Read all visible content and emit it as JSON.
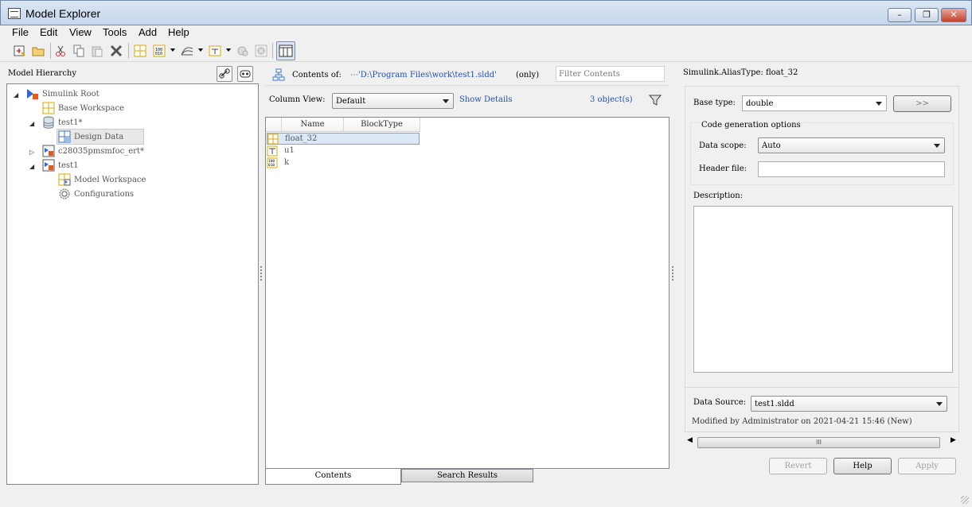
{
  "window": {
    "title": "Model Explorer",
    "minimize_label": "–",
    "restore_label": "❐",
    "close_label": "✕"
  },
  "menu": [
    {
      "label": "File",
      "mnemonic": "F"
    },
    {
      "label": "Edit",
      "mnemonic": "E"
    },
    {
      "label": "View",
      "mnemonic": "V"
    },
    {
      "label": "Tools",
      "mnemonic": "T"
    },
    {
      "label": "Add",
      "mnemonic": "A"
    },
    {
      "label": "Help",
      "mnemonic": "H"
    }
  ],
  "toolbar_icons": [
    "new-model-icon",
    "open-folder-icon",
    "cut-icon",
    "copy-icon",
    "paste-icon",
    "delete-icon",
    "add-workspace-variable-icon",
    "add-parameter-icon",
    "add-signal-icon",
    "add-bus-icon",
    "add-configuration-icon",
    "add-config-ref-icon",
    "dialog-view-icon"
  ],
  "model_hierarchy": {
    "title": "Model Hierarchy",
    "nodes": [
      {
        "label": "Simulink Root",
        "expander": "◢"
      },
      {
        "label": "Base Workspace"
      },
      {
        "label": "test1*",
        "expander": "◢"
      },
      {
        "label": "Design Data"
      },
      {
        "label": "c28035pmsmfoc_ert*",
        "expander": "▷"
      },
      {
        "label": "test1",
        "expander": "◢"
      },
      {
        "label": "Model Workspace"
      },
      {
        "label": "Configurations"
      }
    ]
  },
  "contents": {
    "contents_of_label": "Contents of:",
    "path": "⋯'D:\\Program Files\\work\\test1.sldd'",
    "only_label": "(only)",
    "filter_placeholder": "Filter Contents",
    "column_view_label": "Column View:",
    "column_view_value": "Default",
    "show_details": "Show Details",
    "object_count": "3 object(s)",
    "columns": [
      "Name",
      "BlockType"
    ],
    "rows": [
      {
        "name": "float_32",
        "icon": "alias-type-icon"
      },
      {
        "name": "u1",
        "icon": "bus-icon"
      },
      {
        "name": "k",
        "icon": "parameter-icon"
      }
    ],
    "tabs": [
      {
        "label": "Contents",
        "mnemonic": "C"
      },
      {
        "label": "Search Results",
        "mnemonic": "S"
      }
    ]
  },
  "dialog": {
    "title": "Simulink.AliasType: float_32",
    "base_type_label": "Base type:",
    "base_type_value": "double",
    "expand_button": ">>",
    "code_gen_label": "Code generation options",
    "data_scope_label": "Data scope:",
    "data_scope_value": "Auto",
    "header_file_label": "Header file:",
    "header_file_value": "",
    "description_label": "Description:",
    "data_source_label": "Data Source:",
    "data_source_value": "test1.sldd",
    "modified_text": "Modified by Administrator on 2021-04-21 15:46 (New)",
    "scroll_thumb": "III",
    "buttons": {
      "revert": "Revert",
      "help": "Help",
      "apply": "Apply"
    }
  }
}
